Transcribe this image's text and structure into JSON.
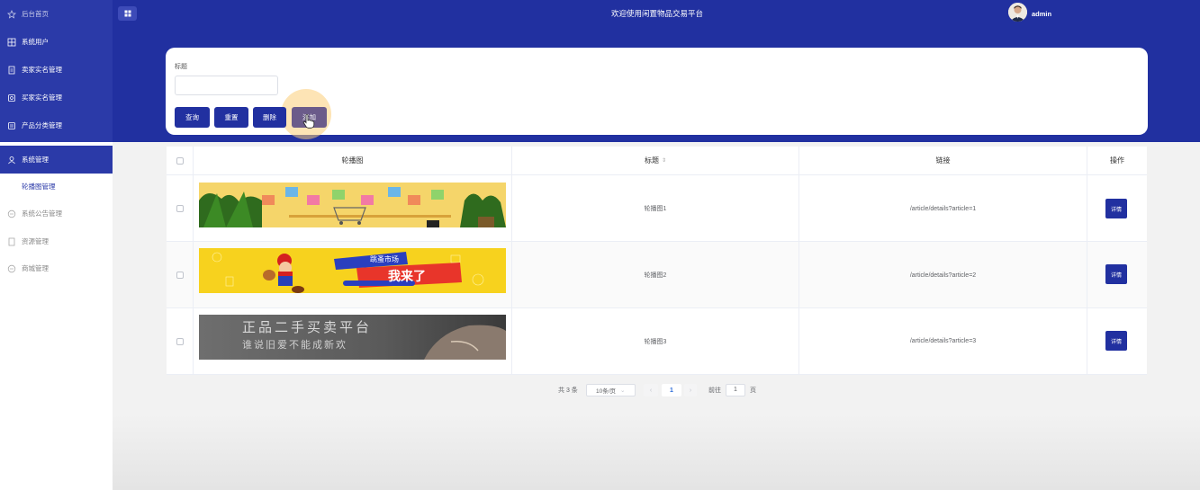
{
  "header": {
    "site_title": "欢迎使用闲置物品交易平台",
    "username": "admin"
  },
  "sidebar": {
    "items": [
      {
        "label": "后台首页",
        "icon": "star-icon"
      },
      {
        "label": "系统用户",
        "icon": "grid-icon"
      },
      {
        "label": "卖家实名管理",
        "icon": "doc-icon"
      },
      {
        "label": "买家实名管理",
        "icon": "doc-icon"
      },
      {
        "label": "产品分类管理",
        "icon": "doc-icon"
      },
      {
        "label": "系统管理",
        "icon": "user-icon"
      },
      {
        "label": "轮播图管理",
        "icon": ""
      },
      {
        "label": "系统公告管理",
        "icon": "clock-icon"
      },
      {
        "label": "资源管理",
        "icon": "doc-icon"
      },
      {
        "label": "商城管理",
        "icon": "clock-icon"
      }
    ]
  },
  "search": {
    "label": "标题",
    "input_value": "",
    "buttons": {
      "query": "查询",
      "reset": "重置",
      "delete": "删除",
      "add": "添加"
    }
  },
  "table": {
    "headers": {
      "image": "轮播图",
      "title": "标题",
      "sort_glyph": "⇕",
      "link": "链接",
      "action": "操作"
    },
    "rows": [
      {
        "title": "轮播图1",
        "link": "/article/details?article=1",
        "action": "详情",
        "banner": "shopping-cart-banner"
      },
      {
        "title": "轮播图2",
        "link": "/article/details?article=2",
        "action": "详情",
        "banner": "mario-market-banner"
      },
      {
        "title": "轮播图3",
        "link": "/article/details?article=3",
        "action": "详情",
        "banner": "secondhand-platform-banner"
      }
    ]
  },
  "banners": {
    "b2_title": "跳蚤市场",
    "b2_big": "我来了",
    "b3_line1": "正品二手买卖平台",
    "b3_line2": "谁说旧爱不能成新欢"
  },
  "pagination": {
    "total": "共 3 条",
    "page_size": "10条/页",
    "current": "1",
    "goto_label": "前往",
    "goto_value": "1",
    "page_suffix": "页"
  },
  "colors": {
    "primary": "#2130a0",
    "sidebar": "#2b3aa8",
    "accent_add": "#6b5b8a"
  }
}
